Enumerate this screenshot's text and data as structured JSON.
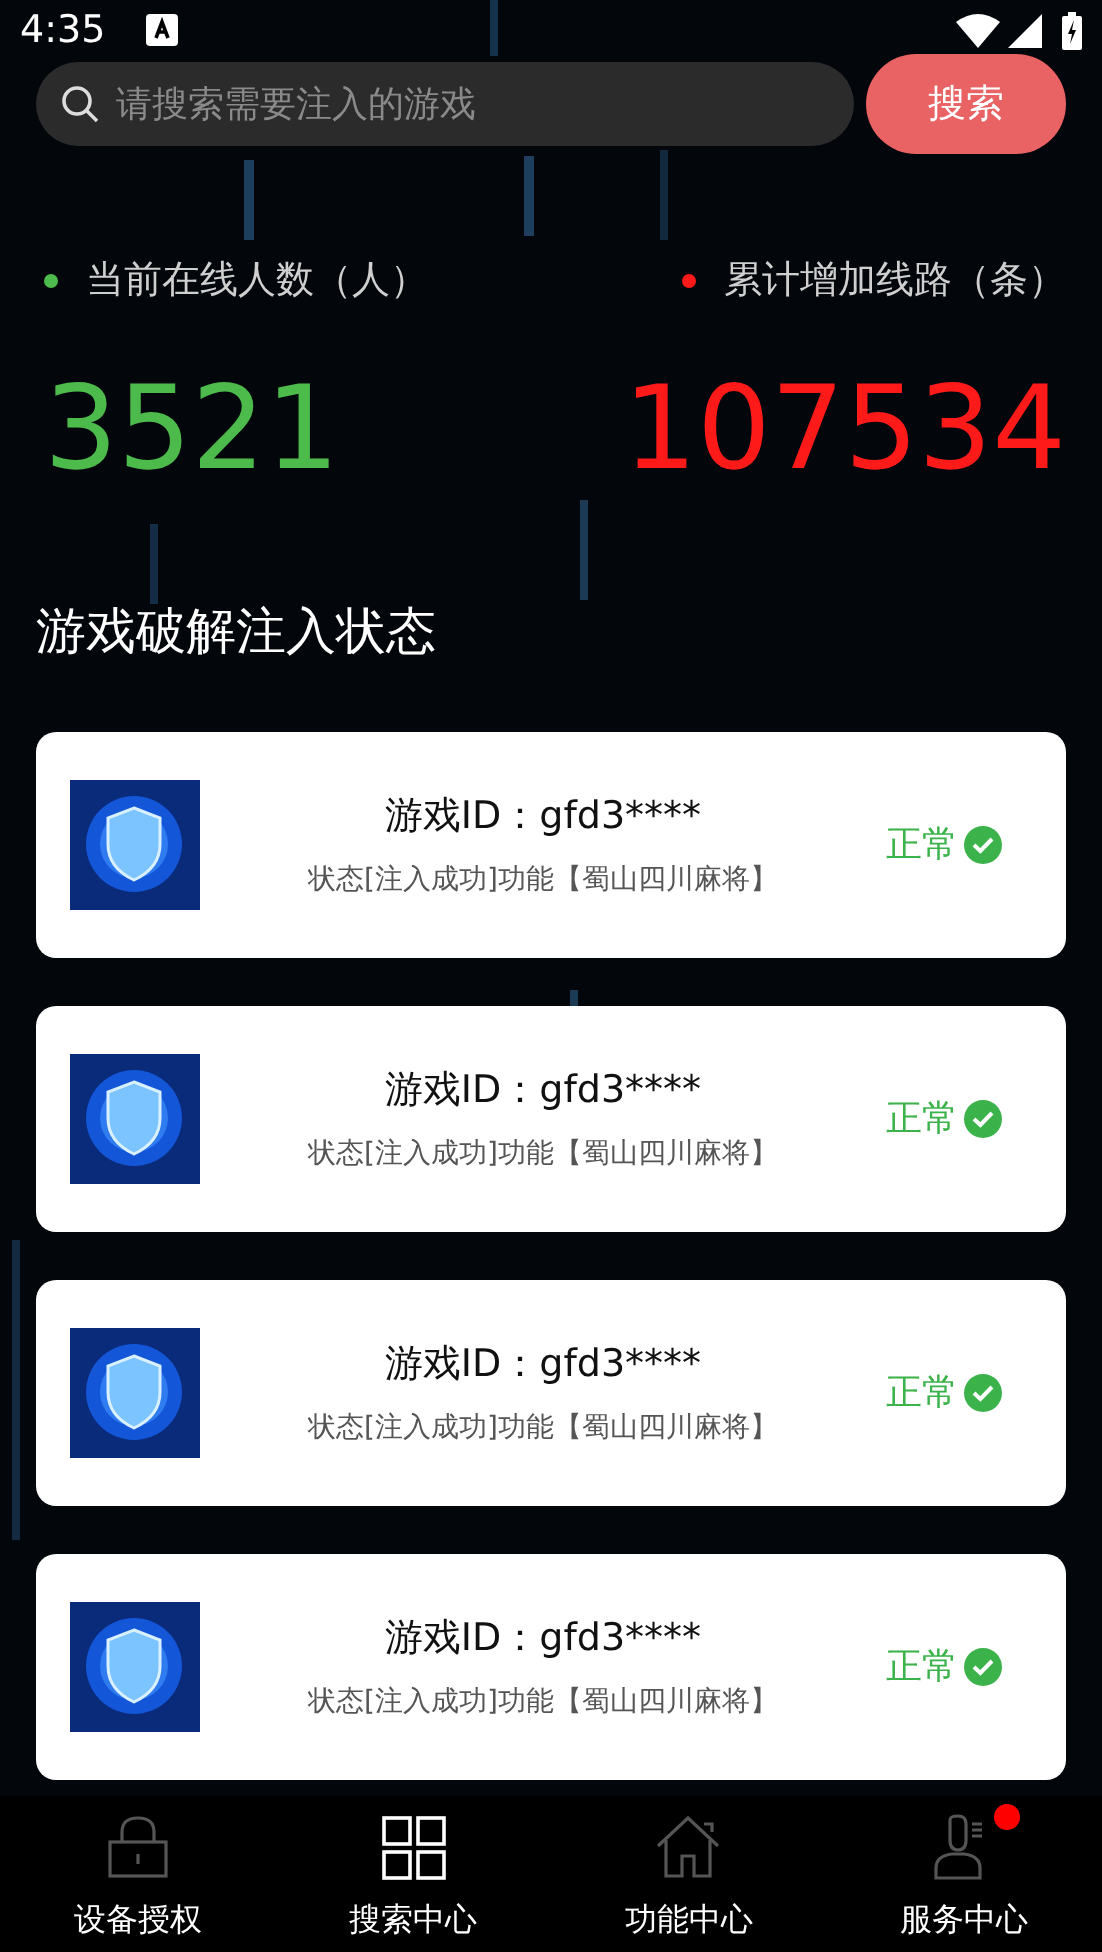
{
  "status_bar": {
    "time": "4:35"
  },
  "search": {
    "placeholder": "请搜索需要注入的游戏",
    "button": "搜索"
  },
  "stats": [
    {
      "label": "当前在线人数（人）",
      "value": "3521",
      "color": "#4cbb4c"
    },
    {
      "label": "累计增加线路（条）",
      "value": "107534",
      "color": "#ff1a1a"
    }
  ],
  "section_title": "游戏破解注入状态",
  "cards": [
    {
      "title": "游戏ID：gfd3****",
      "detail": "状态[注入成功]功能【蜀山四川麻将】",
      "status": "正常",
      "ok": true
    },
    {
      "title": "游戏ID：gfd3****",
      "detail": "状态[注入成功]功能【蜀山四川麻将】",
      "status": "正常",
      "ok": true
    },
    {
      "title": "游戏ID：gfd3****",
      "detail": "状态[注入成功]功能【蜀山四川麻将】",
      "status": "正常",
      "ok": true
    },
    {
      "title": "游戏ID：gfd3****",
      "detail": "状态[注入成功]功能【蜀山四川麻将】",
      "status": "正常",
      "ok": true
    }
  ],
  "nav": [
    {
      "label": "设备授权",
      "selected": false,
      "badge": false
    },
    {
      "label": "搜索中心",
      "selected": true,
      "badge": false
    },
    {
      "label": "功能中心",
      "selected": false,
      "badge": false
    },
    {
      "label": "服务中心",
      "selected": false,
      "badge": true
    }
  ]
}
